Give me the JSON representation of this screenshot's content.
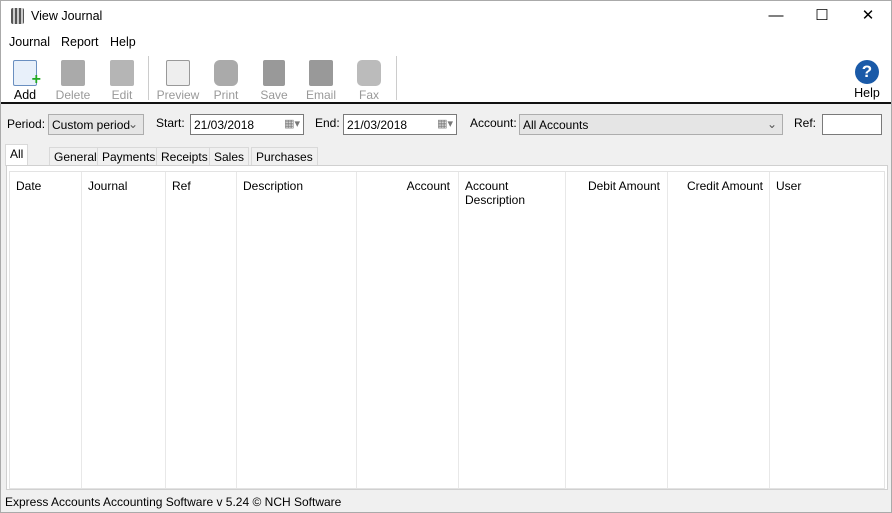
{
  "window": {
    "title": "View Journal",
    "icon": "calculator-icon",
    "controls": [
      "minimize",
      "maximize",
      "close"
    ]
  },
  "menu": [
    "Journal",
    "Report",
    "Help"
  ],
  "toolbar": [
    {
      "label": "Add",
      "icon": "add-document-icon",
      "enabled": true
    },
    {
      "label": "Delete",
      "icon": "delete-icon",
      "enabled": false
    },
    {
      "label": "Edit",
      "icon": "edit-icon",
      "enabled": false
    },
    {
      "label": "Preview",
      "icon": "preview-icon",
      "enabled": false
    },
    {
      "label": "Print",
      "icon": "printer-icon",
      "enabled": false
    },
    {
      "label": "Save",
      "icon": "save-icon",
      "enabled": false
    },
    {
      "label": "Email",
      "icon": "email-icon",
      "enabled": false
    },
    {
      "label": "Fax",
      "icon": "fax-icon",
      "enabled": false
    }
  ],
  "help": {
    "label": "Help",
    "icon": "help-icon"
  },
  "filters": {
    "period_label": "Period:",
    "period_value": "Custom period",
    "start_label": "Start:",
    "start_value": "21/03/2018",
    "end_label": "End:",
    "end_value": "21/03/2018",
    "account_label": "Account:",
    "account_value": "All Accounts",
    "ref_label": "Ref:",
    "ref_value": ""
  },
  "tabs": [
    "All",
    "General",
    "Payments",
    "Receipts",
    "Sales",
    "Purchases"
  ],
  "active_tab": "All",
  "columns": [
    "Date",
    "Journal",
    "Ref",
    "Description",
    "Account",
    "Account Description",
    "Debit Amount",
    "Credit Amount",
    "User"
  ],
  "rows": [],
  "status": "Express Accounts Accounting Software v 5.24 © NCH Software"
}
